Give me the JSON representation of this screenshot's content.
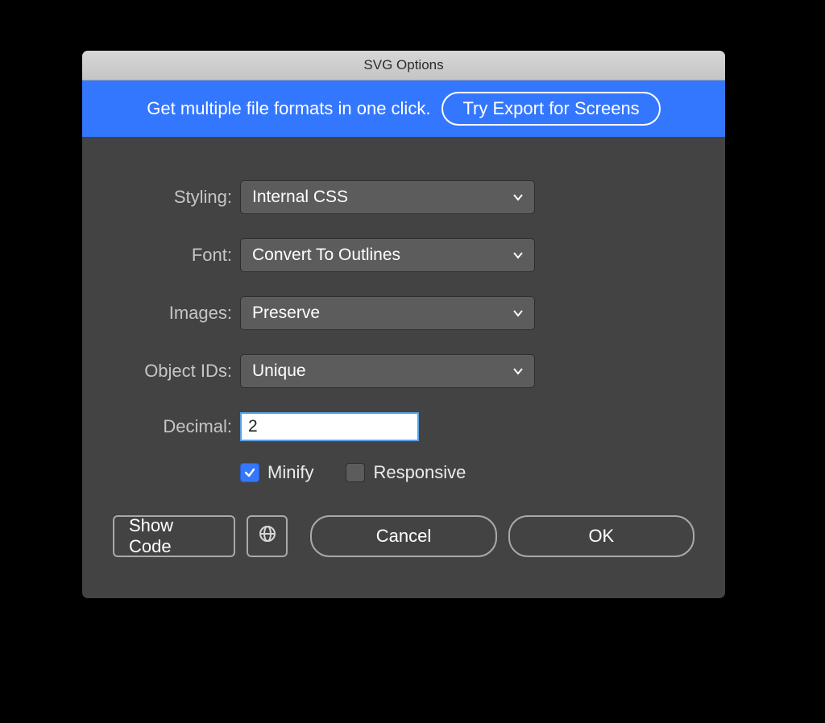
{
  "titlebar": {
    "title": "SVG Options"
  },
  "promo": {
    "text": "Get multiple file formats in one click.",
    "button": "Try Export for Screens"
  },
  "form": {
    "styling": {
      "label": "Styling:",
      "value": "Internal CSS"
    },
    "font": {
      "label": "Font:",
      "value": "Convert To Outlines"
    },
    "images": {
      "label": "Images:",
      "value": "Preserve"
    },
    "objectIds": {
      "label": "Object IDs:",
      "value": "Unique"
    },
    "decimal": {
      "label": "Decimal:",
      "value": "2"
    },
    "minify": {
      "label": "Minify",
      "checked": true
    },
    "responsive": {
      "label": "Responsive",
      "checked": false
    }
  },
  "footer": {
    "showCode": "Show Code",
    "cancel": "Cancel",
    "ok": "OK"
  }
}
